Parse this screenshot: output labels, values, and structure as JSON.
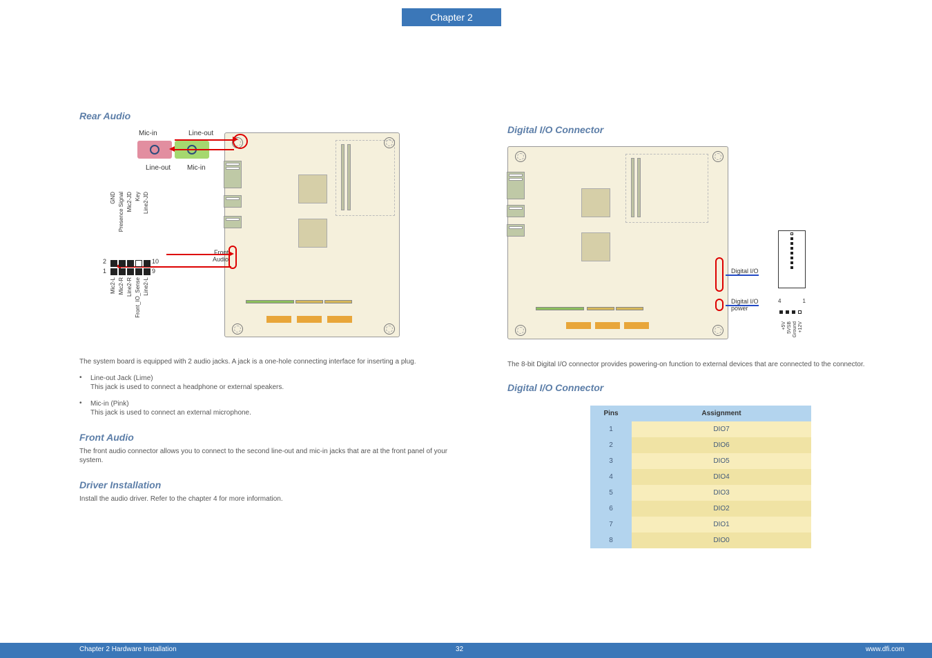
{
  "chapter_tab": "Chapter 2",
  "left": {
    "heading_rear": "Rear Audio",
    "jack_labels": {
      "mic_in": "Mic-in",
      "line_out": "Line-out"
    },
    "front_audio_text": "Front\nAudio",
    "pin_top_labels": [
      "GND",
      "Presence Signal",
      "Mic2-JD",
      "Key",
      "Line2-JD"
    ],
    "pin_bottom_labels": [
      "Mic2-L",
      "Mic2-R",
      "Line2-R",
      "Front_IO_Sense",
      "Line2-L"
    ],
    "pin_num_2": "2",
    "pin_num_1": "1",
    "pin_num_10": "10",
    "pin_num_9": "9",
    "para1": "The system board is equipped with 2 audio jacks. A jack is a one-hole connecting interface for inserting a plug.",
    "bullet1_title": "Line-out Jack (Lime)",
    "bullet1_body": "This jack is used to connect a headphone or external speakers.",
    "bullet2_title": "Mic-in (Pink)",
    "bullet2_body": "This jack is used to connect an external microphone.",
    "heading_front": "Front Audio",
    "para_front": "The front audio connector allows you to connect to the second line-out and mic-in jacks that are at the front panel of your system.",
    "heading_driver": "Driver Installation",
    "para_driver": "Install the audio driver. Refer to the chapter 4 for more information."
  },
  "right": {
    "heading_dio": "Digital I/O Connector",
    "callout1": "Digital I/O",
    "callout2": "Digital I/O power",
    "power_num_4": "4",
    "power_num_1": "1",
    "power_labels": [
      "+5V",
      "5VSB",
      "Ground",
      "+12V"
    ],
    "para_dio": "The 8-bit Digital I/O connector provides powering-on function to external devices that are connected to the connector.",
    "heading_settings": "Digital I/O Connector",
    "table_head_pins": "Pins",
    "table_head_assign": "Assignment",
    "rows": [
      {
        "pin": "1",
        "a": "DIO7"
      },
      {
        "pin": "2",
        "a": "DIO6"
      },
      {
        "pin": "3",
        "a": "DIO5"
      },
      {
        "pin": "4",
        "a": "DIO4"
      },
      {
        "pin": "5",
        "a": "DIO3"
      },
      {
        "pin": "6",
        "a": "DIO2"
      },
      {
        "pin": "7",
        "a": "DIO1"
      },
      {
        "pin": "8",
        "a": "DIO0"
      }
    ]
  },
  "footer": {
    "left": "Chapter 2 Hardware Installation",
    "page": "32",
    "right": "www.dfi.com"
  }
}
